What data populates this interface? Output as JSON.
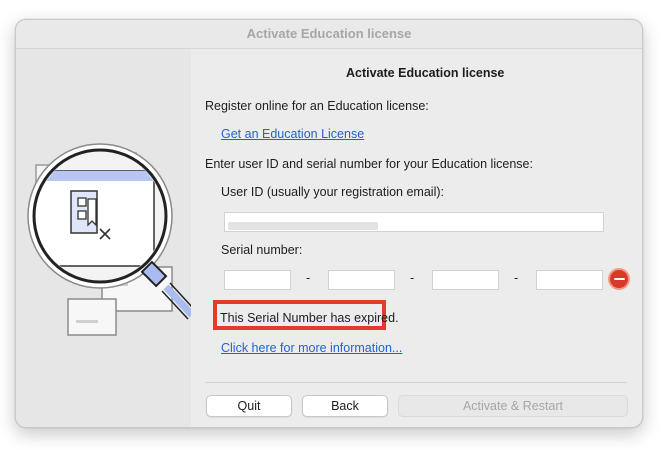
{
  "window": {
    "title": "Activate Education license"
  },
  "dialog": {
    "heading": "Activate Education license",
    "register_text": "Register online for an Education license:",
    "get_license_link": "Get an Education License",
    "enter_text": "Enter user ID and serial number for your Education license:",
    "user_id_label": "User ID (usually your registration email):",
    "user_id_value": "",
    "serial_label": "Serial number:",
    "serial_parts": [
      "",
      "",
      "",
      ""
    ],
    "serial_separator": "-",
    "error_message": "This Serial Number has expired.",
    "more_info_link": "Click here for more information..."
  },
  "buttons": {
    "quit": "Quit",
    "back": "Back",
    "activate": "Activate & Restart"
  },
  "icons": {
    "error": "error-minus-icon",
    "illustration": "magnifier-license-icon"
  },
  "colors": {
    "link": "#1f63d1",
    "error_highlight": "#e23a2d",
    "error_icon": "#d9382a",
    "magnifier_handle": "#a9bcf2"
  }
}
